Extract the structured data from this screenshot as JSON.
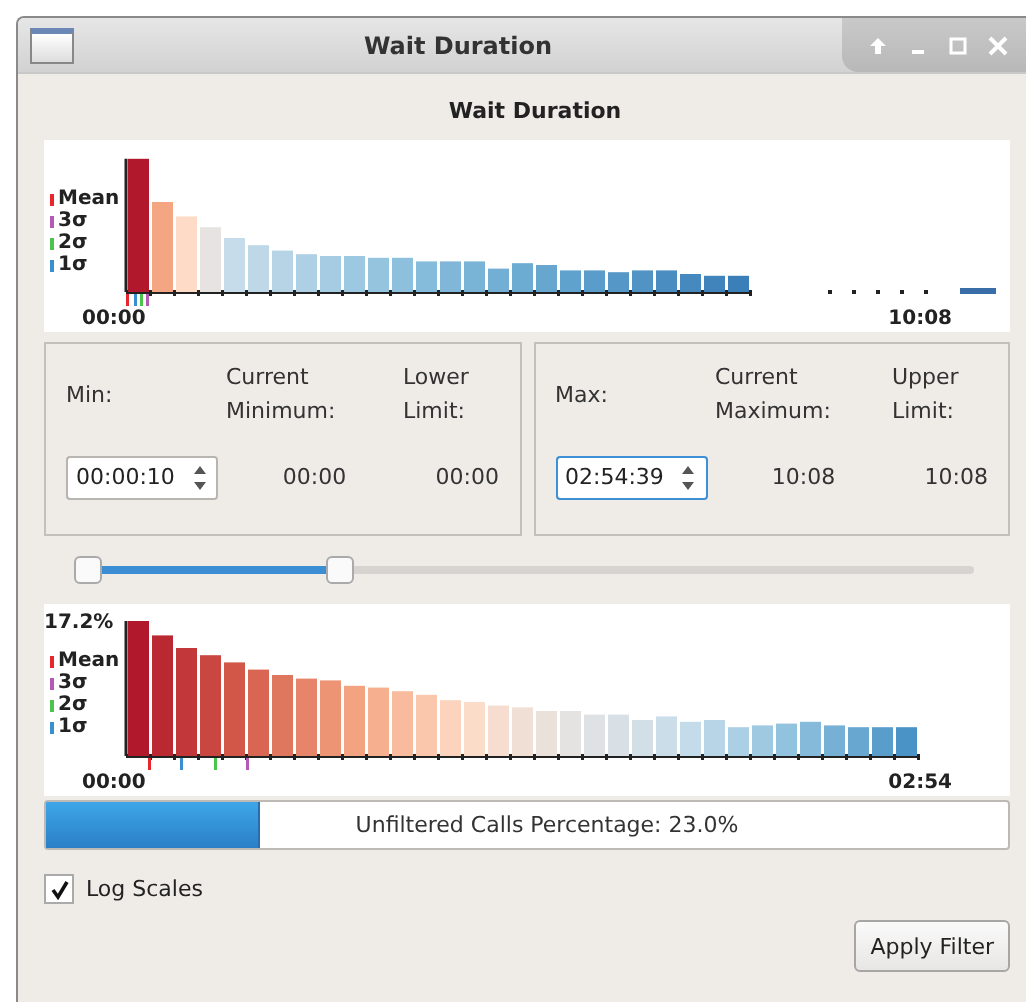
{
  "window": {
    "title": "Wait Duration"
  },
  "heading": "Wait Duration",
  "full_histogram": {
    "legend": [
      {
        "label": "Mean",
        "color": "#e8262b"
      },
      {
        "label": "3σ",
        "color": "#b45ab4"
      },
      {
        "label": "2σ",
        "color": "#4cc44c"
      },
      {
        "label": "1σ",
        "color": "#3a8fd0"
      }
    ],
    "x_start": "00:00",
    "x_end": "10:08"
  },
  "min_group": {
    "label": "Min:",
    "value": "00:00:10",
    "current_label": "Current Minimum:",
    "current": "00:00",
    "limit_label": "Lower Limit:",
    "limit": "00:00",
    "focused": false
  },
  "max_group": {
    "label": "Max:",
    "value": "02:54:39",
    "current_label": "Current Maximum:",
    "current": "10:08",
    "limit_label": "Upper Limit:",
    "limit": "10:08",
    "focused": true
  },
  "range_slider": {
    "handles": [
      {
        "level": 0.01
      },
      {
        "level": 0.29
      }
    ]
  },
  "filtered_histogram": {
    "peak_label": "17.2%",
    "legend": [
      {
        "label": "Mean",
        "color": "#e8262b"
      },
      {
        "label": "3σ",
        "color": "#b45ab4"
      },
      {
        "label": "2σ",
        "color": "#4cc44c"
      },
      {
        "label": "1σ",
        "color": "#3a8fd0"
      }
    ],
    "x_start": "00:00",
    "x_end": "02:54"
  },
  "progress": {
    "level": 0.22,
    "text": "Unfiltered Calls Percentage: 23.0%"
  },
  "log_scales": {
    "label": "Log Scales",
    "checked": true
  },
  "apply_button": "Apply Filter"
}
